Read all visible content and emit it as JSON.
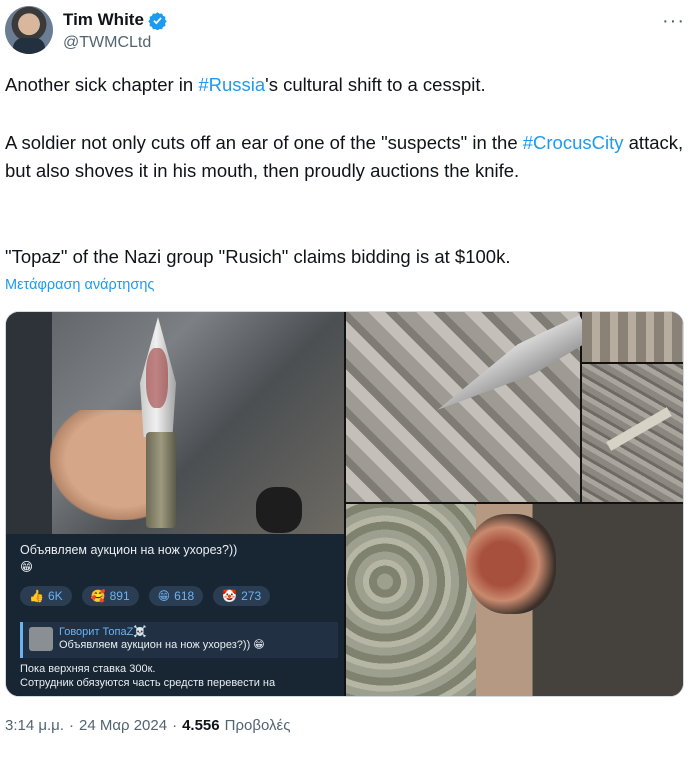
{
  "author": {
    "display_name": "Tim White",
    "handle": "@TWMCLtd"
  },
  "tweet": {
    "p1_before": "Another sick chapter in ",
    "p1_tag": "#Russia",
    "p1_after": "'s cultural shift to a cesspit.",
    "p2_before": "A soldier not only cuts off an ear of one of the \"suspects\" in the ",
    "p2_tag": "#CrocusCity",
    "p2_after": " attack, but also shoves it in his mouth, then proudly auctions the knife.",
    "p3": "\"Topaz\" of the Nazi group \"Rusich\" claims bidding is at $100k.",
    "translate_label": "Μετάφραση ανάρτησης"
  },
  "media": {
    "telegram": {
      "caption": "Объявляем аукцион на нож ухорез?))",
      "caption_emoji": "😁",
      "reactions": [
        {
          "emoji": "👍",
          "count": "6K"
        },
        {
          "emoji": "🥰",
          "count": "891"
        },
        {
          "emoji": "😁",
          "count": "618"
        },
        {
          "emoji": "🤡",
          "count": "273"
        }
      ],
      "quote_author": "Говорит ТопаZ☠️",
      "quote_text": "Объявляем аукцион на нож ухорез?)) 😁",
      "body_line1": "Пока верхняя ставка 300к.",
      "body_line2": "Сотрудник обязуются часть средств перевести на"
    }
  },
  "meta": {
    "time": "3:14 μ.μ.",
    "sep1": "·",
    "date": "24 Μαρ 2024",
    "sep2": "·",
    "views": "4.556",
    "views_label": "Προβολές"
  },
  "colors": {
    "link": "#1d9bf0",
    "verified": "#1d9bf0"
  }
}
